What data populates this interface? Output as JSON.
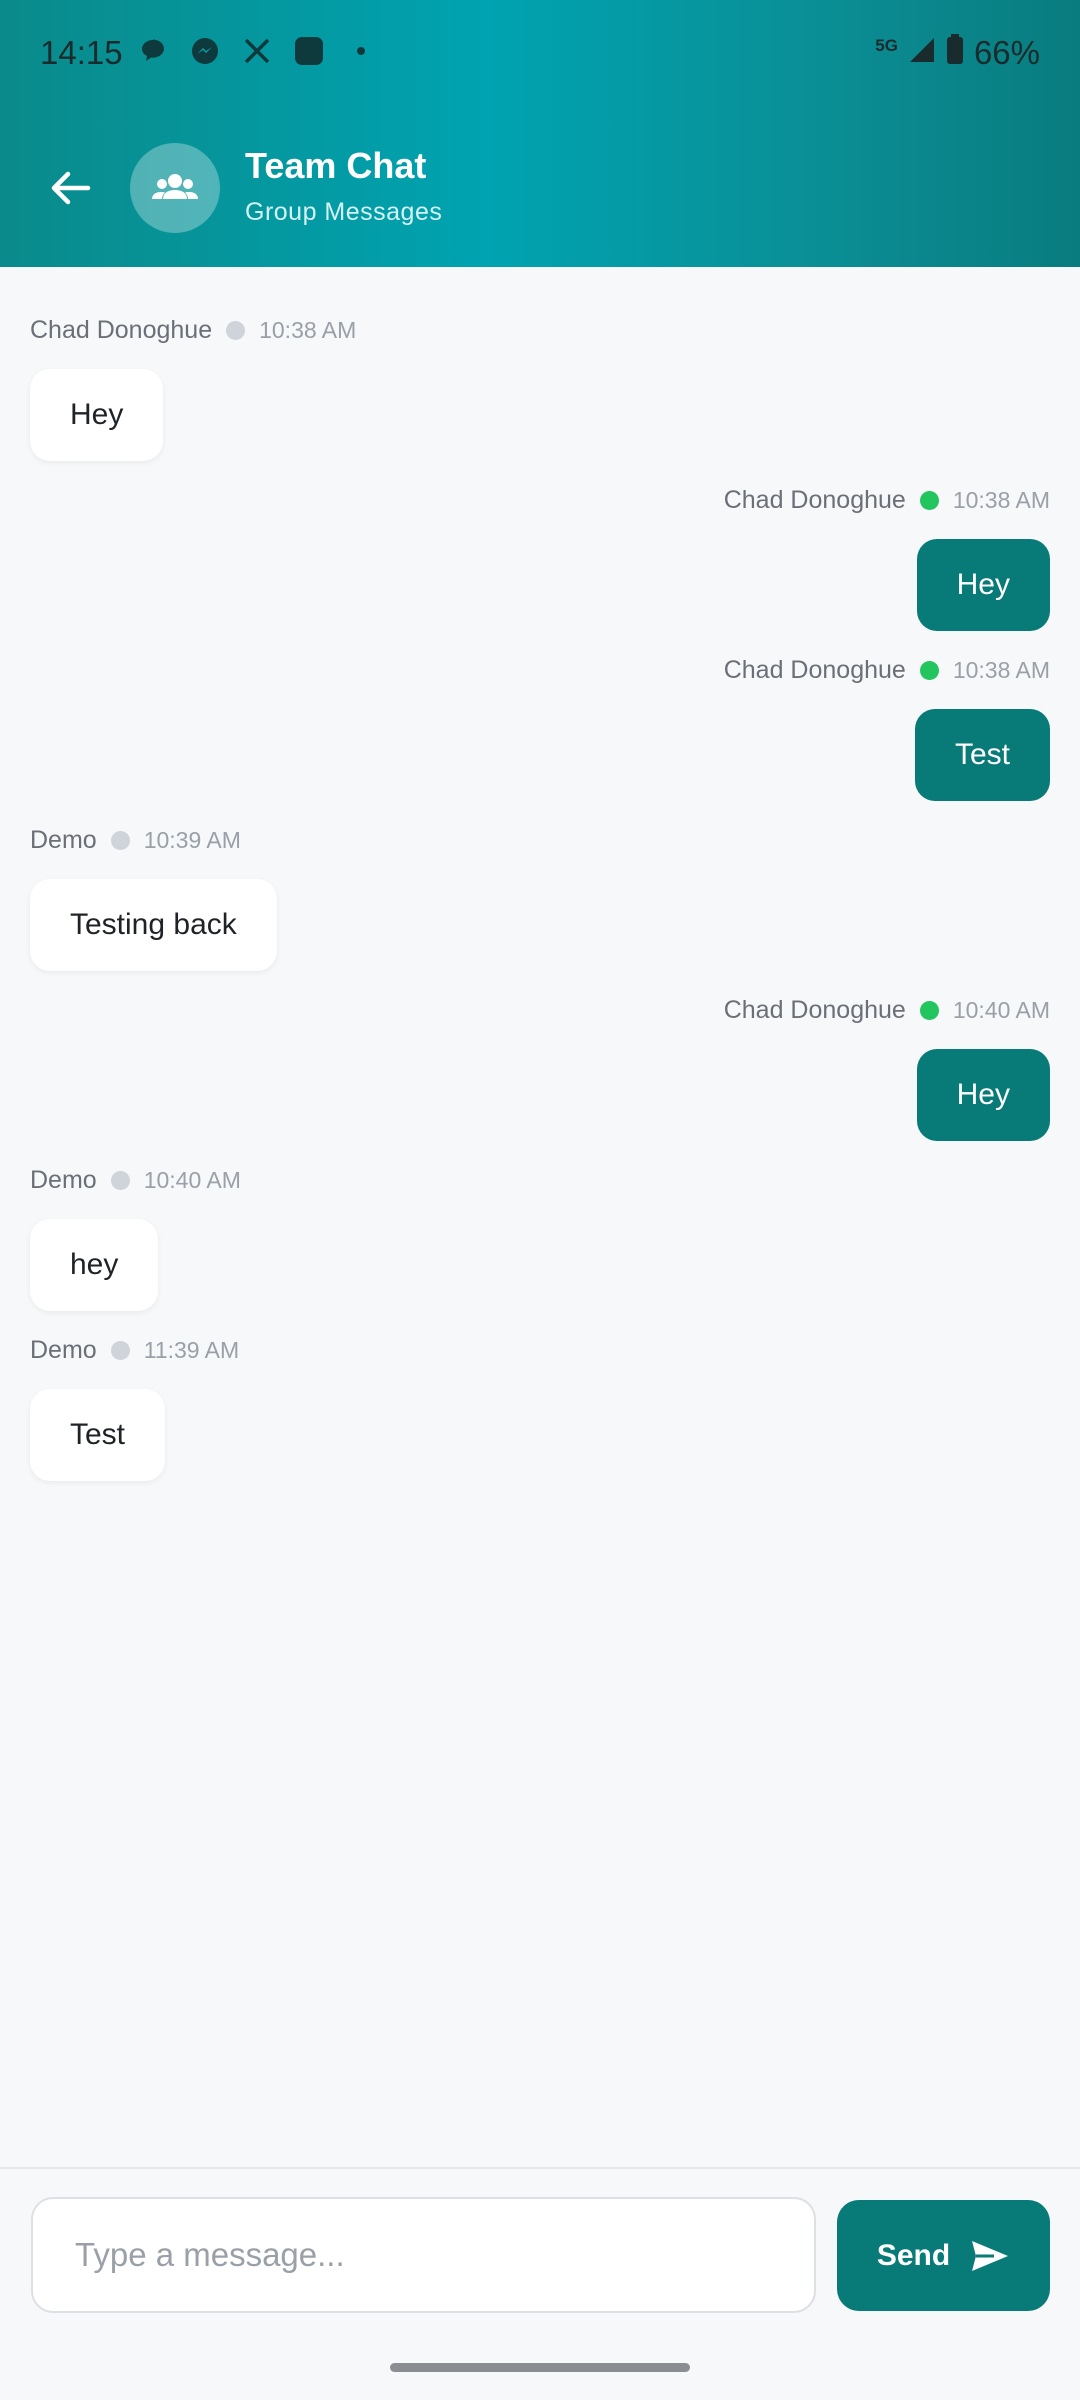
{
  "status_bar": {
    "time": "14:15",
    "network": "5G",
    "battery": "66%",
    "notification_icons": [
      "chat-bubble-icon",
      "messenger-icon",
      "x-icon",
      "app-icon",
      "more-dot-icon"
    ]
  },
  "header": {
    "title": "Team Chat",
    "subtitle": "Group Messages",
    "back_icon": "arrow-left-icon",
    "avatar_icon": "group-icon"
  },
  "messages": [
    {
      "sender": "Chad Donoghue",
      "time": "10:38 AM",
      "text": "Hey",
      "side": "left",
      "online": false
    },
    {
      "sender": "Chad Donoghue",
      "time": "10:38 AM",
      "text": "Hey",
      "side": "right",
      "online": true
    },
    {
      "sender": "Chad Donoghue",
      "time": "10:38 AM",
      "text": "Test",
      "side": "right",
      "online": true
    },
    {
      "sender": "Demo",
      "time": "10:39 AM",
      "text": "Testing back",
      "side": "left",
      "online": false
    },
    {
      "sender": "Chad Donoghue",
      "time": "10:40 AM",
      "text": "Hey",
      "side": "right",
      "online": true
    },
    {
      "sender": "Demo",
      "time": "10:40 AM",
      "text": "hey",
      "side": "left",
      "online": false
    },
    {
      "sender": "Demo",
      "time": "11:39 AM",
      "text": "Test",
      "side": "left",
      "online": false
    }
  ],
  "composer": {
    "placeholder": "Type a message...",
    "value": "",
    "send_label": "Send"
  },
  "colors": {
    "accent": "#087a78",
    "online": "#22c55e",
    "offline": "#cfd3da"
  }
}
